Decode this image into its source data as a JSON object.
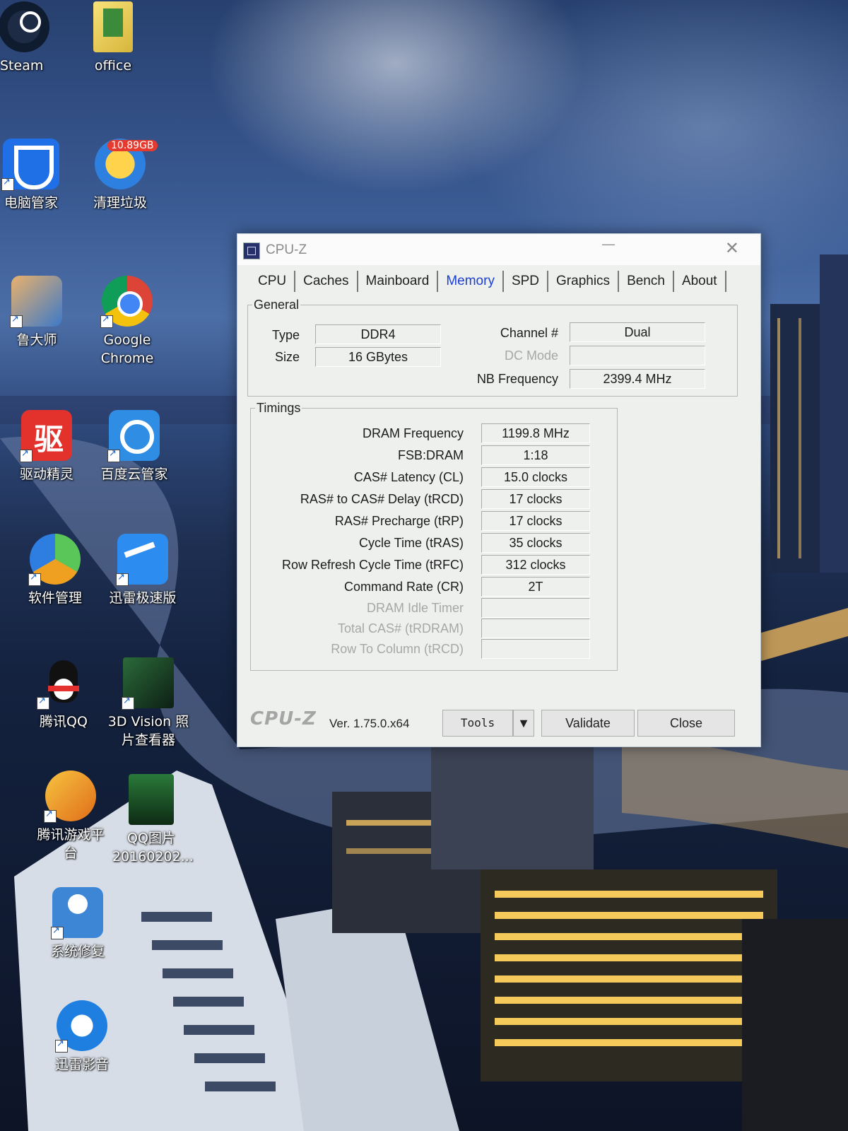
{
  "desktop": {
    "icons": [
      {
        "label": "Steam"
      },
      {
        "label": "office"
      },
      {
        "label": "电脑管家"
      },
      {
        "label": "清理垃圾",
        "badge": "10.89GB"
      },
      {
        "label": "鲁大师"
      },
      {
        "label": "Google Chrome"
      },
      {
        "label": "驱动精灵"
      },
      {
        "label": "百度云管家"
      },
      {
        "label": "软件管理"
      },
      {
        "label": "迅雷极速版"
      },
      {
        "label": "腾讯QQ"
      },
      {
        "label": "3D Vision 照片查看器"
      },
      {
        "label": "腾讯游戏平台"
      },
      {
        "label": "QQ图片20160202..."
      },
      {
        "label": "系统修复"
      },
      {
        "label": "迅雷影音"
      }
    ]
  },
  "window": {
    "title": "CPU-Z",
    "tabs": [
      "CPU",
      "Caches",
      "Mainboard",
      "Memory",
      "SPD",
      "Graphics",
      "Bench",
      "About"
    ],
    "active_tab": "Memory",
    "general": {
      "legend": "General",
      "type_label": "Type",
      "type_value": "DDR4",
      "size_label": "Size",
      "size_value": "16 GBytes",
      "channel_label": "Channel #",
      "channel_value": "Dual",
      "dc_mode_label": "DC Mode",
      "dc_mode_value": "",
      "nb_freq_label": "NB Frequency",
      "nb_freq_value": "2399.4 MHz"
    },
    "timings": {
      "legend": "Timings",
      "rows": [
        {
          "label": "DRAM Frequency",
          "value": "1199.8 MHz"
        },
        {
          "label": "FSB:DRAM",
          "value": "1:18"
        },
        {
          "label": "CAS# Latency (CL)",
          "value": "15.0 clocks"
        },
        {
          "label": "RAS# to CAS# Delay (tRCD)",
          "value": "17 clocks"
        },
        {
          "label": "RAS# Precharge (tRP)",
          "value": "17 clocks"
        },
        {
          "label": "Cycle Time (tRAS)",
          "value": "35 clocks"
        },
        {
          "label": "Row Refresh Cycle Time (tRFC)",
          "value": "312 clocks"
        },
        {
          "label": "Command Rate (CR)",
          "value": "2T"
        },
        {
          "label": "DRAM Idle Timer",
          "value": ""
        },
        {
          "label": "Total CAS# (tRDRAM)",
          "value": ""
        },
        {
          "label": "Row To Column (tRCD)",
          "value": ""
        }
      ]
    },
    "footer": {
      "logo": "CPU-Z",
      "version": "Ver. 1.75.0.x64",
      "tools": "Tools",
      "validate": "Validate",
      "close": "Close"
    }
  }
}
